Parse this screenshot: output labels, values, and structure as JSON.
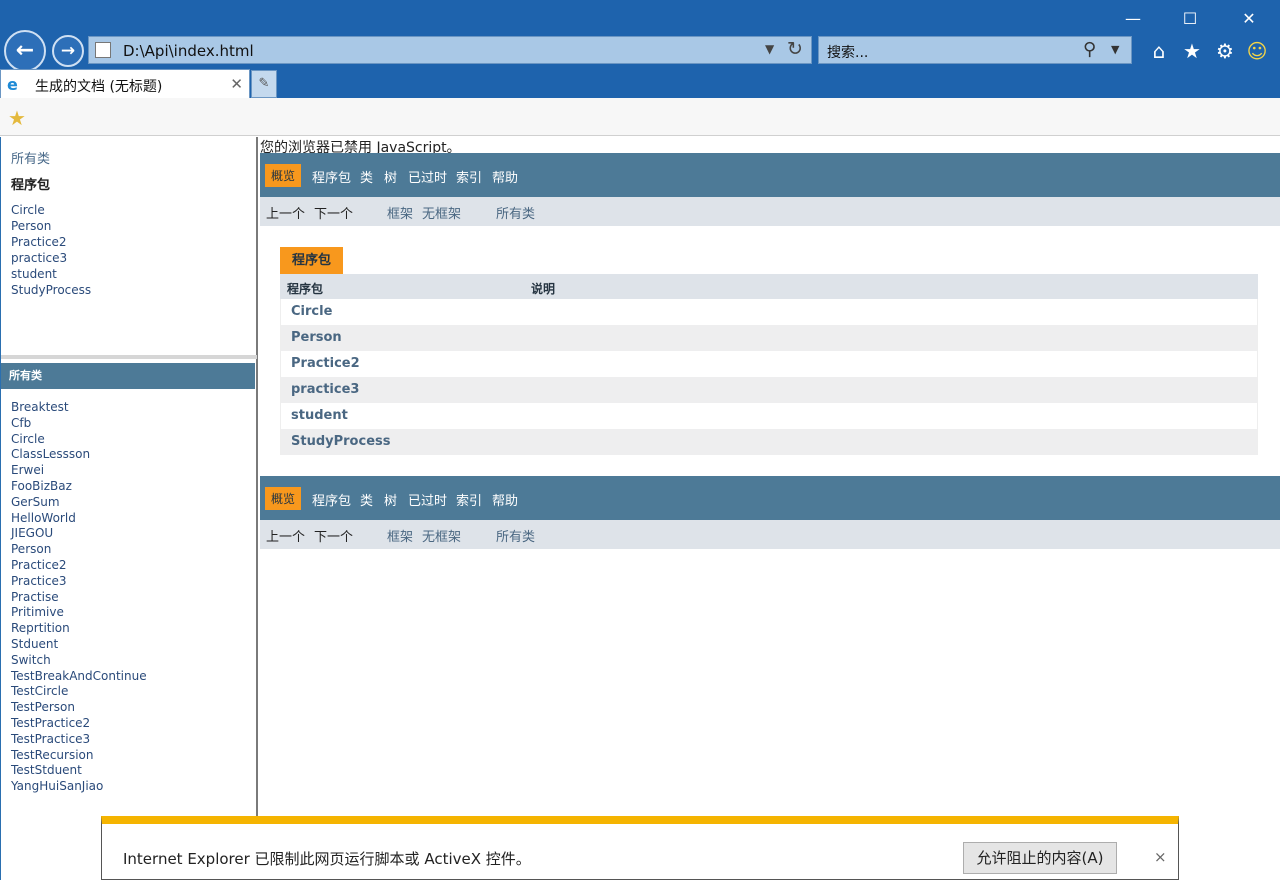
{
  "window": {
    "minimize": "—",
    "maximize": "☐",
    "close": "✕"
  },
  "toolbar": {
    "back": "←",
    "forward": "→",
    "address": "D:\\Api\\index.html",
    "search_placeholder": "搜索...",
    "home": "⌂",
    "favorites": "★",
    "settings": "⚙",
    "feedback": "☺"
  },
  "tab": {
    "title": "生成的文档 (无标题)",
    "close": "✕",
    "new_tab": "✎"
  },
  "left": {
    "all_classes_link": "所有类",
    "packages_heading": "程序包",
    "packages": [
      "Circle",
      "Person",
      "Practice2",
      "practice3",
      "student",
      "StudyProcess"
    ],
    "classes_heading": "所有类",
    "classes": [
      "Breaktest",
      "Cfb",
      "Circle",
      "ClassLessson",
      "Erwei",
      "FooBizBaz",
      "GerSum",
      "HelloWorld",
      "JIEGOU",
      "Person",
      "Practice2",
      "Practice3",
      "Practise",
      "Pritimive",
      "Reprtition",
      "Stduent",
      "Switch",
      "TestBreakAndContinue",
      "TestCircle",
      "TestPerson",
      "TestPractice2",
      "TestPractice3",
      "TestRecursion",
      "TestStduent",
      "YangHuiSanJiao"
    ]
  },
  "main": {
    "nojs": "您的浏览器已禁用 JavaScript。",
    "nav": {
      "overview": "概览",
      "package": "程序包",
      "class": "类",
      "tree": "树",
      "deprecated": "已过时",
      "index": "索引",
      "help": "帮助"
    },
    "subnav": {
      "prev": "上一个",
      "next": "下一个",
      "frames": "框架",
      "noframes": "无框架",
      "allclasses": "所有类"
    },
    "table": {
      "caption": "程序包",
      "col_package": "程序包",
      "col_desc": "说明",
      "rows": [
        "Circle",
        "Person",
        "Practice2",
        "practice3",
        "student",
        "StudyProcess"
      ]
    }
  },
  "notification": {
    "message": "Internet Explorer 已限制此网页运行脚本或 ActiveX 控件。",
    "button": "允许阻止的内容(A)",
    "close": "×"
  }
}
